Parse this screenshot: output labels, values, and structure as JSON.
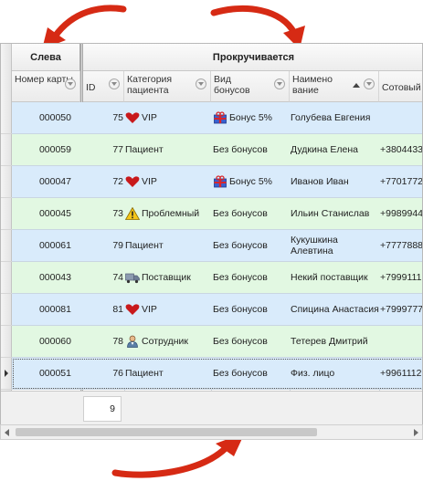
{
  "bands": {
    "left": "Слева",
    "right": "Прокручивается"
  },
  "columns": {
    "card": "Номер карты",
    "id": "ID",
    "category": "Категория пациента",
    "bonus": "Вид бонусов",
    "name": "Наименование",
    "phone": "Сотовый"
  },
  "rows": [
    {
      "card": "000050",
      "id": "75",
      "category": "VIP",
      "cat_icon": "heart-icon",
      "bonus": "Бонус 5%",
      "bonus_icon": "gift-icon",
      "name": "Голубева Евгения",
      "phone": ""
    },
    {
      "card": "000059",
      "id": "77",
      "category": "Пациент",
      "cat_icon": "",
      "bonus": "Без бонусов",
      "bonus_icon": "",
      "name": "Дудкина Елена",
      "phone": "+3804433"
    },
    {
      "card": "000047",
      "id": "72",
      "category": "VIP",
      "cat_icon": "heart-icon",
      "bonus": "Бонус 5%",
      "bonus_icon": "gift-icon",
      "name": "Иванов Иван",
      "phone": "+7701772"
    },
    {
      "card": "000045",
      "id": "73",
      "category": "Проблемный",
      "cat_icon": "warning-icon",
      "bonus": "Без бонусов",
      "bonus_icon": "",
      "name": "Ильин Станислав",
      "phone": "+9989944"
    },
    {
      "card": "000061",
      "id": "79",
      "category": "Пациент",
      "cat_icon": "",
      "bonus": "Без бонусов",
      "bonus_icon": "",
      "name": "Кукушкина Алевтина",
      "phone": "+7777888"
    },
    {
      "card": "000043",
      "id": "74",
      "category": "Поставщик",
      "cat_icon": "truck-icon",
      "bonus": "Без бонусов",
      "bonus_icon": "",
      "name": "Некий поставщик",
      "phone": "+7999111"
    },
    {
      "card": "000081",
      "id": "81",
      "category": "VIP",
      "cat_icon": "heart-icon",
      "bonus": "Без бонусов",
      "bonus_icon": "",
      "name": "Спицина Анастасия",
      "phone": "+7999777"
    },
    {
      "card": "000060",
      "id": "78",
      "category": "Сотрудник",
      "cat_icon": "employee-icon",
      "bonus": "Без бонусов",
      "bonus_icon": "",
      "name": "Тетерев Дмитрий",
      "phone": ""
    },
    {
      "card": "000051",
      "id": "76",
      "category": "Пациент",
      "cat_icon": "",
      "bonus": "Без бонусов",
      "bonus_icon": "",
      "name": "Физ. лицо",
      "phone": "+9961112"
    }
  ],
  "footer": {
    "count": "9"
  },
  "colors": {
    "row_blue": "#d9ebfb",
    "row_green": "#e2f8e2",
    "arrow": "#d62a14"
  }
}
